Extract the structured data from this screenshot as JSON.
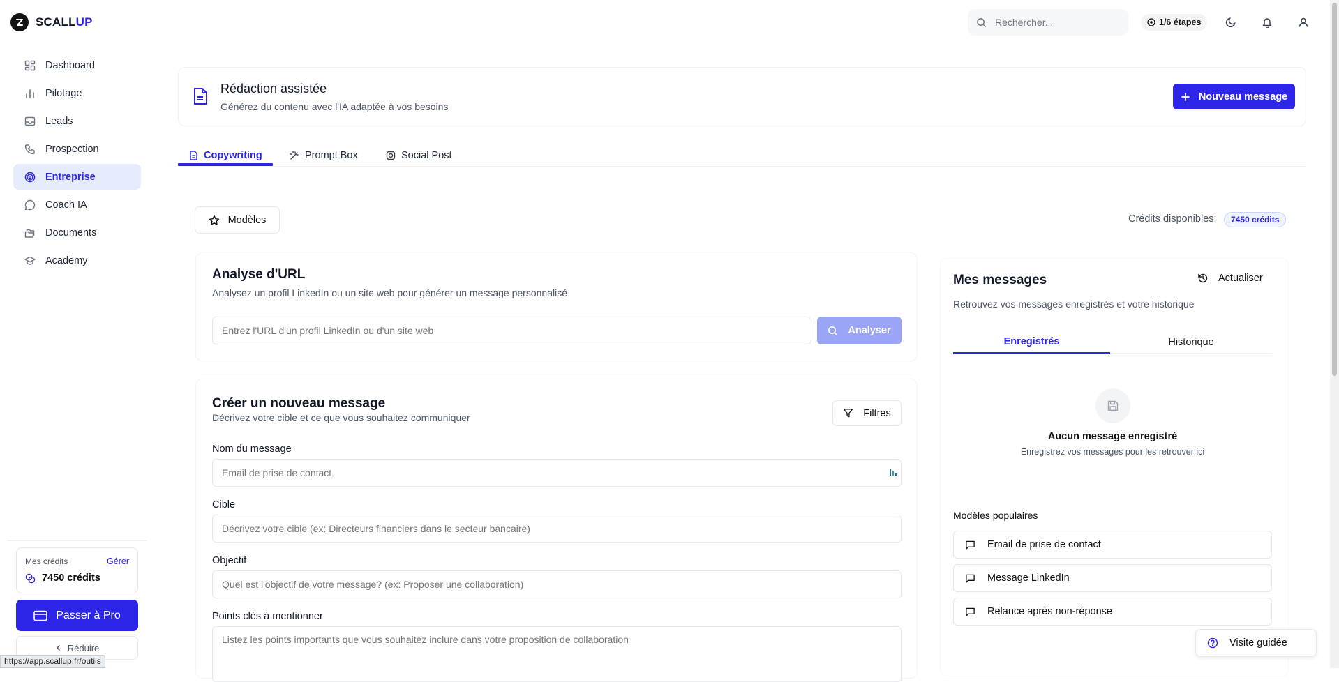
{
  "app": {
    "brand_part1": "SCALL",
    "brand_part2": "UP"
  },
  "sidebar": {
    "items": [
      {
        "label": "Dashboard",
        "icon": "dashboard-icon"
      },
      {
        "label": "Pilotage",
        "icon": "bar-chart-icon"
      },
      {
        "label": "Leads",
        "icon": "inbox-icon"
      },
      {
        "label": "Prospection",
        "icon": "phone-icon"
      },
      {
        "label": "Entreprise",
        "icon": "target-icon",
        "active": true
      },
      {
        "label": "Coach IA",
        "icon": "chat-icon"
      },
      {
        "label": "Documents",
        "icon": "folder-icon"
      },
      {
        "label": "Academy",
        "icon": "graduation-cap-icon"
      }
    ],
    "credits_label": "Mes crédits",
    "credits_manage": "Gérer",
    "credits_value": "7450 crédits",
    "pro_button": "Passer à Pro",
    "reduce_button": "Réduire",
    "status_url": "https://app.scallup.fr/outils"
  },
  "header": {
    "search_placeholder": "Rechercher...",
    "steps": "1/6 étapes"
  },
  "page": {
    "title": "Rédaction assistée",
    "subtitle": "Générez du contenu avec l'IA adaptée à vos besoins",
    "new_message_button": "Nouveau message"
  },
  "tabs": [
    {
      "label": "Copywriting",
      "icon": "document-icon",
      "active": true
    },
    {
      "label": "Prompt Box",
      "icon": "magic-wand-icon"
    },
    {
      "label": "Social Post",
      "icon": "instagram-icon"
    }
  ],
  "toolbar": {
    "models_button": "Modèles",
    "credits_label": "Crédits disponibles:",
    "credits_badge": "7450 crédits"
  },
  "url_analysis": {
    "title": "Analyse d'URL",
    "subtitle": "Analysez un profil LinkedIn ou un site web pour générer un message personnalisé",
    "input_placeholder": "Entrez l'URL d'un profil LinkedIn ou d'un site web",
    "analyze_button": "Analyser"
  },
  "new_message": {
    "title": "Créer un nouveau message",
    "subtitle": "Décrivez votre cible et ce que vous souhaitez communiquer",
    "filters_button": "Filtres",
    "fields": [
      {
        "label": "Nom du message",
        "placeholder": "Email de prise de contact"
      },
      {
        "label": "Cible",
        "placeholder": "Décrivez votre cible (ex: Directeurs financiers dans le secteur bancaire)"
      },
      {
        "label": "Objectif",
        "placeholder": "Quel est l'objectif de votre message? (ex: Proposer une collaboration)"
      },
      {
        "label": "Points clés à mentionner",
        "placeholder": "Listez les points importants que vous souhaitez inclure dans votre proposition de collaboration"
      }
    ]
  },
  "messages": {
    "title": "Mes messages",
    "refresh_button": "Actualiser",
    "subtitle": "Retrouvez vos messages enregistrés et votre historique",
    "tabs": [
      {
        "label": "Enregistrés",
        "active": true
      },
      {
        "label": "Historique"
      }
    ],
    "empty_title": "Aucun message enregistré",
    "empty_subtitle": "Enregistrez vos messages pour les retrouver ici",
    "popular_title": "Modèles populaires",
    "popular": [
      "Email de prise de contact",
      "Message LinkedIn",
      "Relance après non-réponse"
    ]
  },
  "guided_tour": "Visite guidée",
  "colors": {
    "accent": "#2d26e8",
    "accent_light": "#e5ebfb",
    "analyze_disabled": "#9aa6f5"
  }
}
